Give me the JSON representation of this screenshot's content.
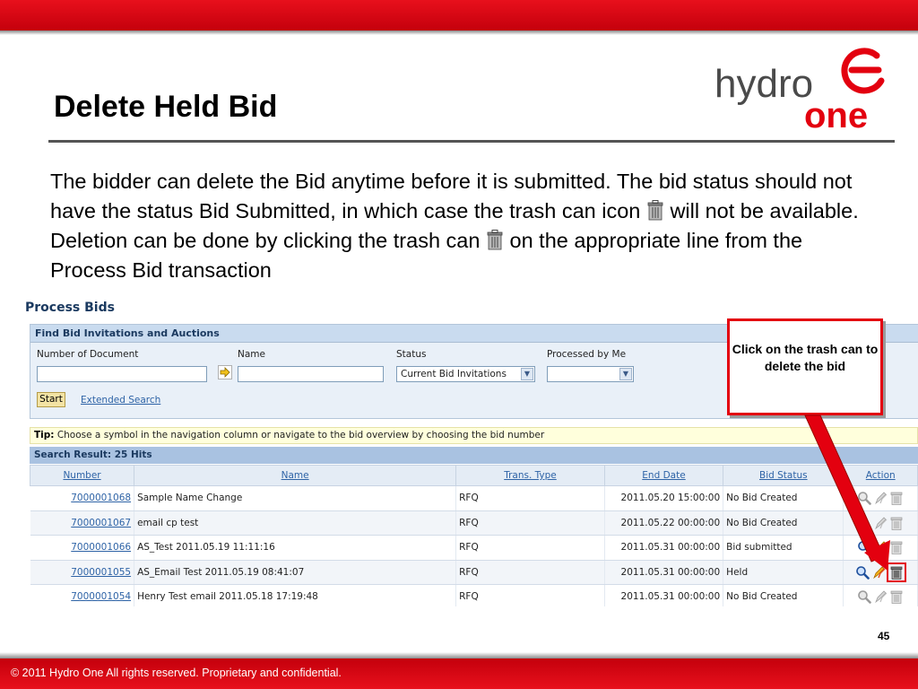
{
  "slide": {
    "title": "Delete Held Bid",
    "body_parts": [
      "The bidder can delete the Bid anytime before it is submitted. The bid status should not have the status Bid Submitted, in which case the trash can icon",
      "will not be available. Deletion can be done by clicking the trash can",
      "on the appropriate line from the Process Bid transaction"
    ],
    "page_number": "45",
    "footer": "© 2011 Hydro One All rights reserved. Proprietary and confidential."
  },
  "logo": {
    "line1": "hydro",
    "line2": "one",
    "brand_color": "#e3000f"
  },
  "process_bids": {
    "title": "Process Bids",
    "find_panel": {
      "header": "Find Bid Invitations and Auctions",
      "fields": {
        "number_label": "Number of Document",
        "number_value": "",
        "name_label": "Name",
        "name_value": "",
        "status_label": "Status",
        "status_value": "Current Bid Invitations",
        "processed_label": "Processed by Me",
        "processed_value": ""
      },
      "start_label": "Start",
      "extended_search_label": "Extended Search"
    },
    "tip": {
      "label": "Tip:",
      "text": " Choose a symbol in the navigation column or navigate to the bid overview by choosing the bid number"
    },
    "search_result": "Search Result:  25 Hits",
    "columns": [
      "Number",
      "Name",
      "Trans. Type",
      "End Date",
      "Bid Status",
      "Action"
    ],
    "rows": [
      {
        "number": "7000001068",
        "name": "Sample Name Change",
        "type": "RFQ",
        "end_date": "2011.05.20 15:00:00",
        "status": "No Bid Created"
      },
      {
        "number": "7000001067",
        "name": "email cp test",
        "type": "RFQ",
        "end_date": "2011.05.22 00:00:00",
        "status": "No Bid Created"
      },
      {
        "number": "7000001066",
        "name": "AS_Test 2011.05.19 11:11:16",
        "type": "RFQ",
        "end_date": "2011.05.31 00:00:00",
        "status": "Bid submitted"
      },
      {
        "number": "7000001055",
        "name": "AS_Email Test 2011.05.19 08:41:07",
        "type": "RFQ",
        "end_date": "2011.05.31 00:00:00",
        "status": "Held"
      },
      {
        "number": "7000001054",
        "name": "Henry Test email 2011.05.18 17:19:48",
        "type": "RFQ",
        "end_date": "2011.05.31 00:00:00",
        "status": "No Bid Created"
      }
    ],
    "action_icons": [
      "magnifier-icon",
      "edit-pencil-icon",
      "trash-can-icon"
    ]
  },
  "callout": {
    "text": "Click on the trash can to delete the bid",
    "border_color": "#e3000f"
  },
  "colors": {
    "red_bar": "#e3000f",
    "table_link": "#2e63a6",
    "header_blue": "#a9c2e1"
  }
}
